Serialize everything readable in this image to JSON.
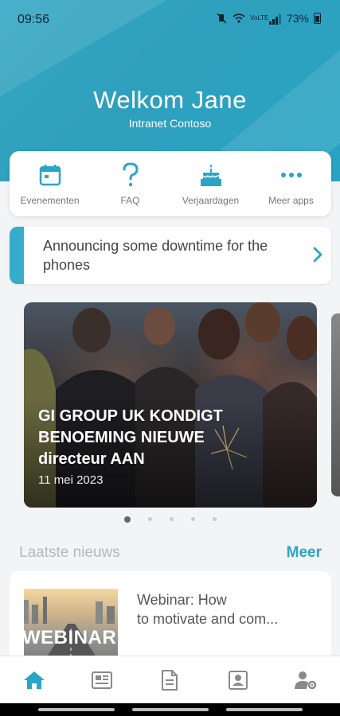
{
  "status_bar": {
    "time": "09:56",
    "battery": "73%",
    "network": "VoLTE"
  },
  "header": {
    "title": "Welkom Jane",
    "subtitle": "Intranet Contoso"
  },
  "quick_links": [
    {
      "label": "Evenementen",
      "icon": "calendar-icon"
    },
    {
      "label": "FAQ",
      "icon": "question-icon"
    },
    {
      "label": "Verjaardagen",
      "icon": "birthday-cake-icon"
    },
    {
      "label": "Meer apps",
      "icon": "more-dots-icon"
    }
  ],
  "announcement": {
    "text": "Announcing some downtime for the phones"
  },
  "carousel": {
    "slides": [
      {
        "title": "GI GROUP UK KONDIGT BENOEMING NIEUWE directeur AAN",
        "date": "11 mei 2023"
      }
    ],
    "page_count": 5,
    "active_index": 0
  },
  "news": {
    "section_label": "Laatste nieuws",
    "more_label": "Meer",
    "items": [
      {
        "title": "Webinar: How\nto motivate and com...",
        "thumb_text": "WEBINAR"
      }
    ]
  },
  "bottom_nav": [
    {
      "icon": "home-icon",
      "active": true
    },
    {
      "icon": "news-icon",
      "active": false
    },
    {
      "icon": "document-icon",
      "active": false
    },
    {
      "icon": "contact-card-icon",
      "active": false
    },
    {
      "icon": "user-settings-icon",
      "active": false
    }
  ],
  "colors": {
    "accent": "#2aa6c4",
    "header": "#35a7c4",
    "background": "#f2f4f5"
  }
}
